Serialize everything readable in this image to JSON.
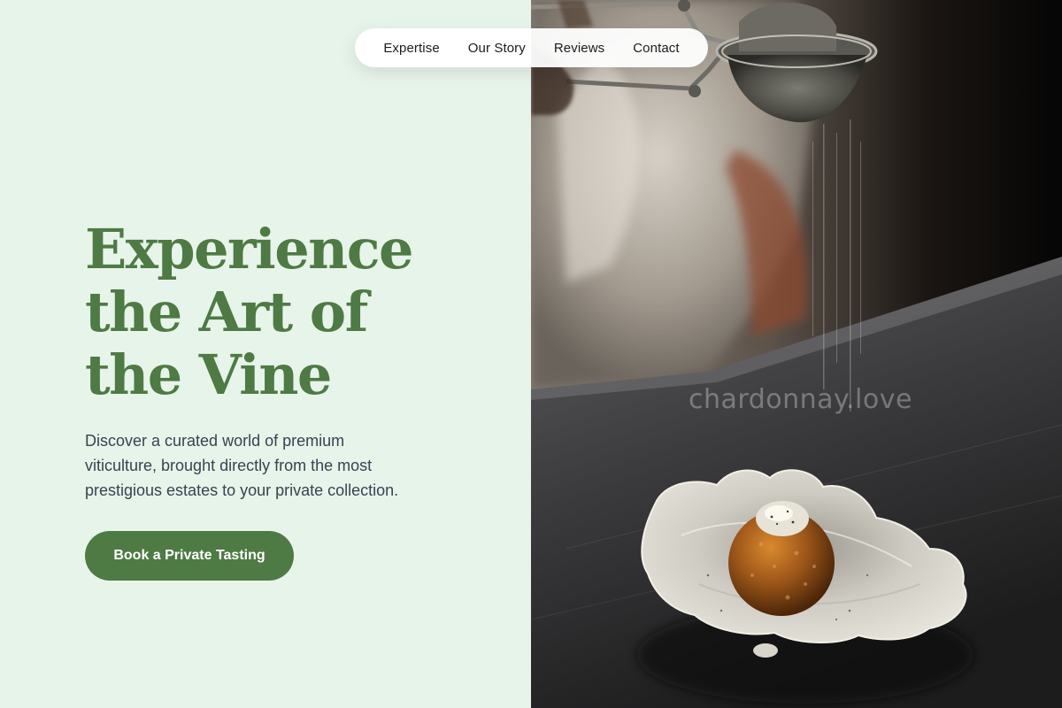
{
  "nav": {
    "items": [
      {
        "label": "Expertise"
      },
      {
        "label": "Our Story"
      },
      {
        "label": "Reviews"
      },
      {
        "label": "Contact"
      }
    ]
  },
  "hero": {
    "title_lines": [
      "Experience",
      "the Art of",
      "the Vine"
    ],
    "subtitle_lines": [
      "Discover a curated world of premium",
      "viticulture, brought directly from the most",
      "prestigious estates to your private collection."
    ],
    "cta_label": "Book a Private Tasting"
  },
  "photo": {
    "watermark": "chardonnay.love",
    "alt": "Chef dusting a golden croquette in a ceramic shell dish with a sieve"
  },
  "colors": {
    "left_background": "#e7f4ea",
    "accent_green": "#4e7a44",
    "body_text": "#3a4250",
    "nav_text": "#1c1c1c"
  }
}
